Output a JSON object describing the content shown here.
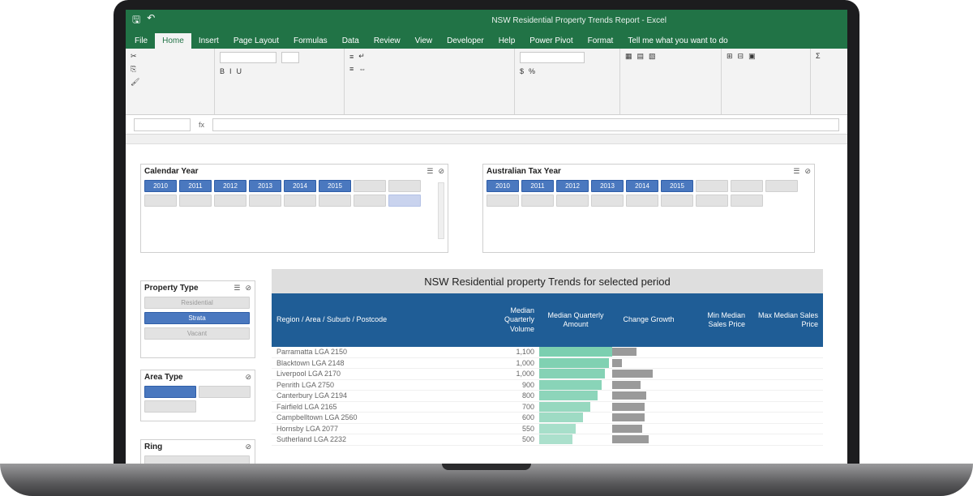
{
  "window": {
    "title": "NSW Residential Property Trends Report - Excel"
  },
  "ribbon_tabs": [
    "File",
    "Home",
    "Insert",
    "Page Layout",
    "Formulas",
    "Data",
    "Review",
    "View",
    "Developer",
    "Help",
    "Power Pivot",
    "Format",
    "Tell me what you want to do"
  ],
  "slicers": {
    "calendar_year": {
      "title": "Calendar Year",
      "selected": [
        "2010",
        "2011",
        "2012",
        "2013",
        "2014",
        "2015"
      ],
      "unselected_count_row1": 2
    },
    "australian_tax_year": {
      "title": "Australian Tax Year",
      "selected": [
        "2010",
        "2011",
        "2012",
        "2013",
        "2014",
        "2015"
      ]
    },
    "property_type": {
      "title": "Property Type",
      "options": [
        "Residential",
        "Strata",
        "Vacant"
      ]
    },
    "area_type": {
      "title": "Area Type"
    },
    "ring": {
      "title": "Ring"
    }
  },
  "report": {
    "title": "NSW Residential property Trends for selected period",
    "columns": [
      "Region / Area / Suburb / Postcode",
      "Median Quarterly Volume",
      "Median Quarterly Amount",
      "Change Growth",
      "Min Median Sales Price",
      "Max Median Sales Price"
    ],
    "rows": [
      {
        "name": "Parramatta LGA 2150",
        "vol": "1,100",
        "amt": 1.0,
        "amt_label": "",
        "growth": 0.6,
        "growth_label": "",
        "min": "",
        "max": ""
      },
      {
        "name": "Blacktown LGA 2148",
        "vol": "1,000",
        "amt": 0.95,
        "amt_label": "",
        "growth": 0.2,
        "growth_label": "",
        "min": "",
        "max": ""
      },
      {
        "name": "Liverpool LGA 2170",
        "vol": "1,000",
        "amt": 0.9,
        "amt_label": "",
        "growth": 1.0,
        "growth_label": "",
        "min": "",
        "max": ""
      },
      {
        "name": "Penrith LGA 2750",
        "vol": "900",
        "amt": 0.85,
        "amt_label": "",
        "growth": 0.7,
        "growth_label": "",
        "min": "",
        "max": ""
      },
      {
        "name": "Canterbury LGA 2194",
        "vol": "800",
        "amt": 0.8,
        "amt_label": "",
        "growth": 0.85,
        "growth_label": "",
        "min": "",
        "max": ""
      },
      {
        "name": "Fairfield LGA 2165",
        "vol": "700",
        "amt": 0.7,
        "amt_label": "",
        "growth": 0.8,
        "growth_label": "",
        "min": "",
        "max": ""
      },
      {
        "name": "Campbelltown LGA 2560",
        "vol": "600",
        "amt": 0.6,
        "amt_label": "",
        "growth": 0.8,
        "growth_label": "",
        "min": "",
        "max": ""
      },
      {
        "name": "Hornsby LGA 2077",
        "vol": "550",
        "amt": 0.5,
        "amt_label": "",
        "growth": 0.75,
        "growth_label": "",
        "min": "",
        "max": ""
      },
      {
        "name": "Sutherland LGA 2232",
        "vol": "500",
        "amt": 0.45,
        "amt_label": "",
        "growth": 0.9,
        "growth_label": "",
        "min": "",
        "max": ""
      }
    ]
  },
  "colors": {
    "excel_green": "#217346",
    "header_blue": "#1f5d96",
    "heat": "#7ccfb0",
    "chip_selected": "#4a78bf"
  }
}
